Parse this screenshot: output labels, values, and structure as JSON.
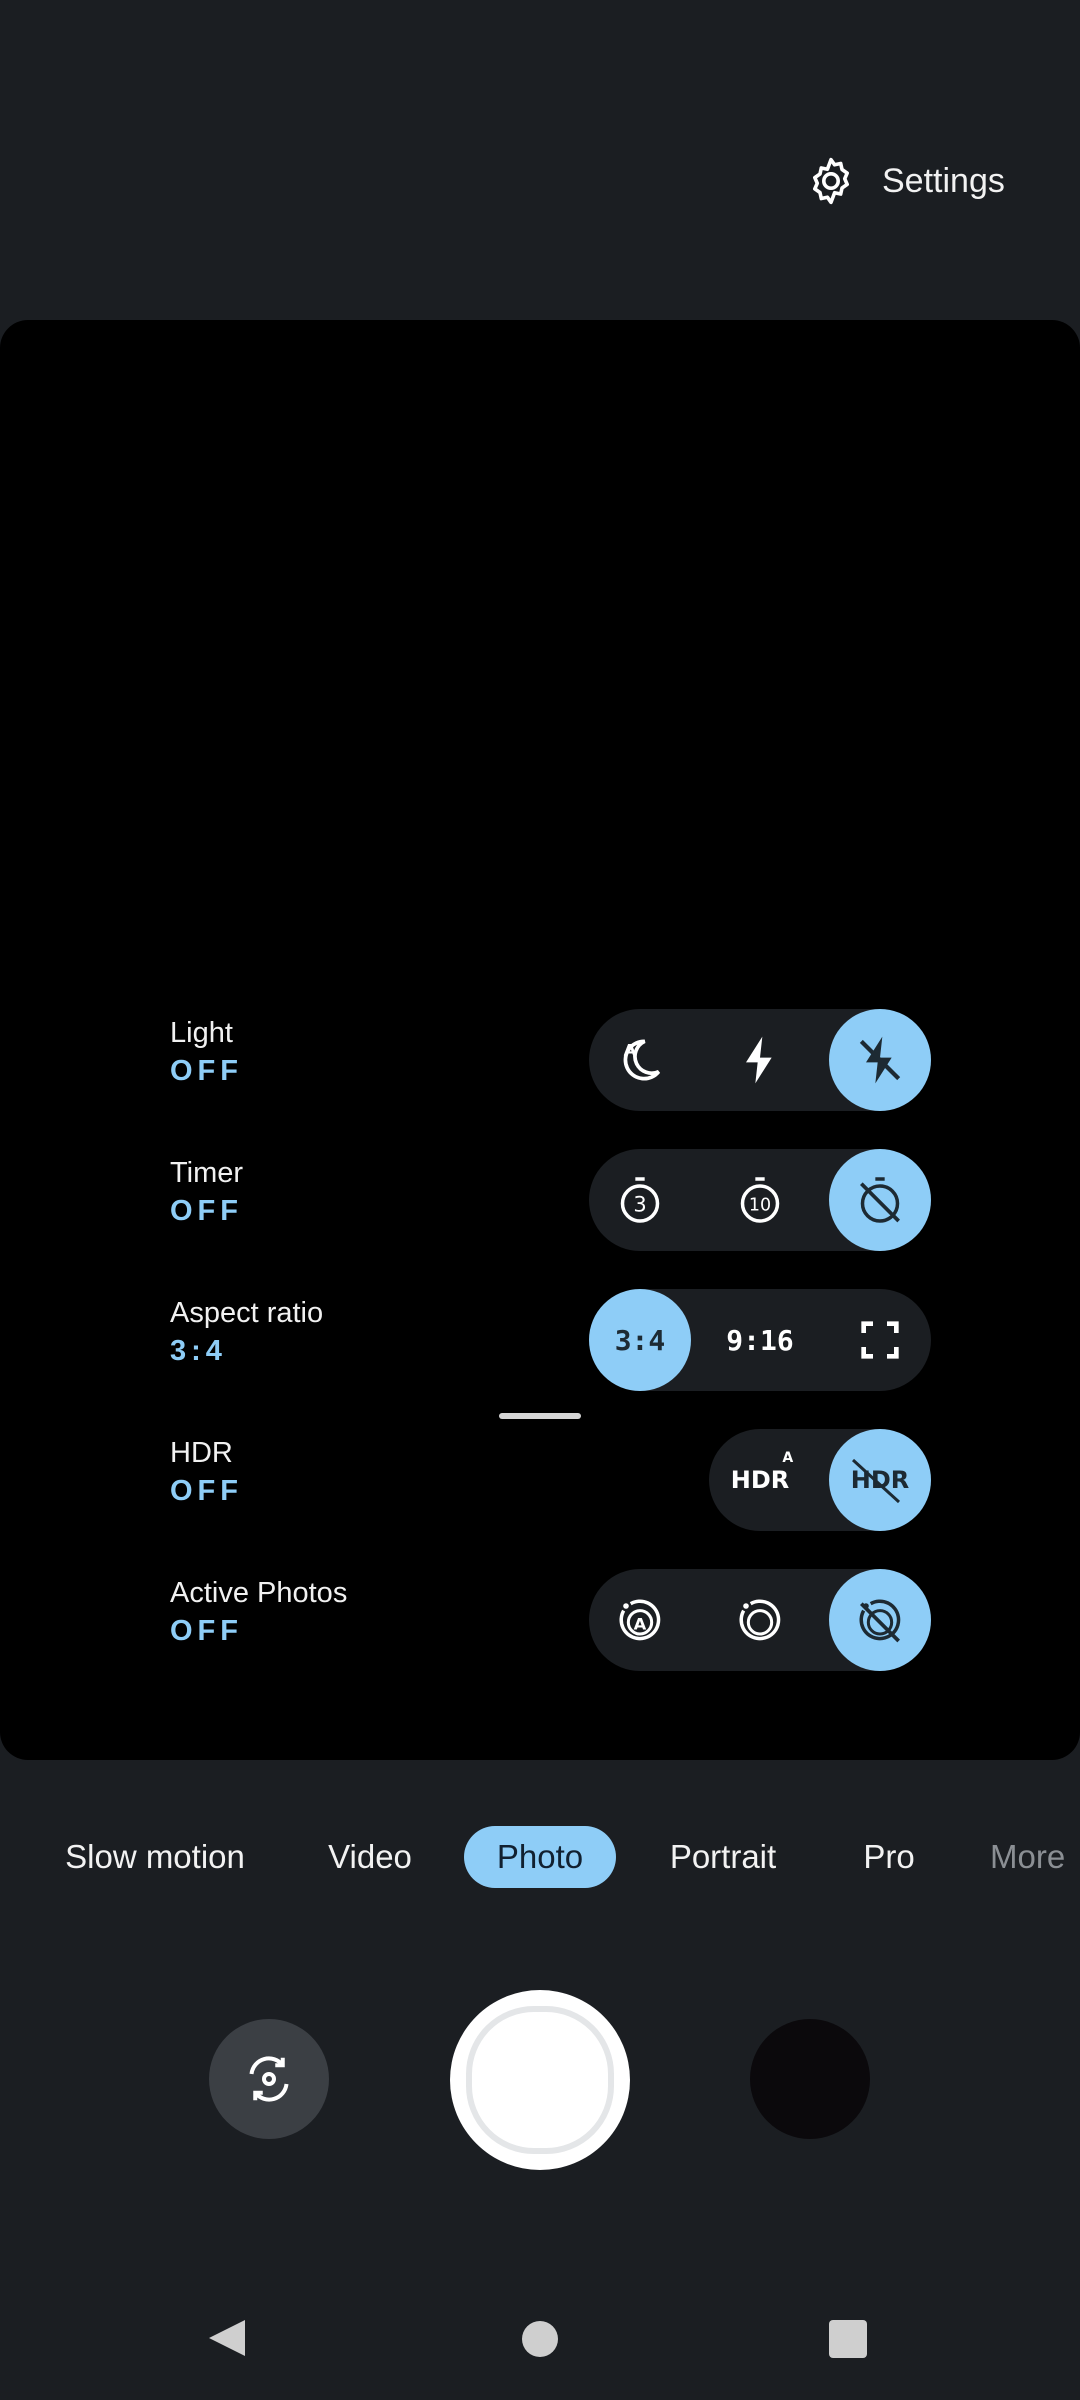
{
  "header": {
    "settings_label": "Settings",
    "settings_icon": "gear-icon"
  },
  "options": {
    "light": {
      "title": "Light",
      "value": "OFF",
      "icons": [
        "night-auto-icon",
        "flash-on-icon",
        "flash-off-icon"
      ],
      "selected": 2
    },
    "timer": {
      "title": "Timer",
      "value": "OFF",
      "icons": [
        "timer-3-icon",
        "timer-10-icon",
        "timer-off-icon"
      ],
      "selected": 2
    },
    "aspect": {
      "title": "Aspect ratio",
      "value": "3:4",
      "choices": [
        "3:4",
        "9:16"
      ],
      "fullscreen_icon": "fullscreen-icon",
      "selected": 0
    },
    "hdr": {
      "title": "HDR",
      "value": "OFF",
      "auto_label": "HDR",
      "auto_badge": "A",
      "off_label": "HDR",
      "selected": 1
    },
    "active_photos": {
      "title": "Active Photos",
      "value": "OFF",
      "icons": [
        "active-photos-auto-icon",
        "active-photos-on-icon",
        "active-photos-off-icon"
      ],
      "selected": 2
    }
  },
  "modes": {
    "items": [
      "Slow motion",
      "Video",
      "Photo",
      "Portrait",
      "Pro",
      "More"
    ],
    "active": "Photo"
  },
  "controls": {
    "switch_camera_icon": "switch-camera-icon",
    "shutter": "shutter-button",
    "gallery": "gallery-thumbnail"
  },
  "colors": {
    "accent": "#8ecdf7",
    "background": "#1b1e22",
    "viewfinder": "#000000"
  }
}
